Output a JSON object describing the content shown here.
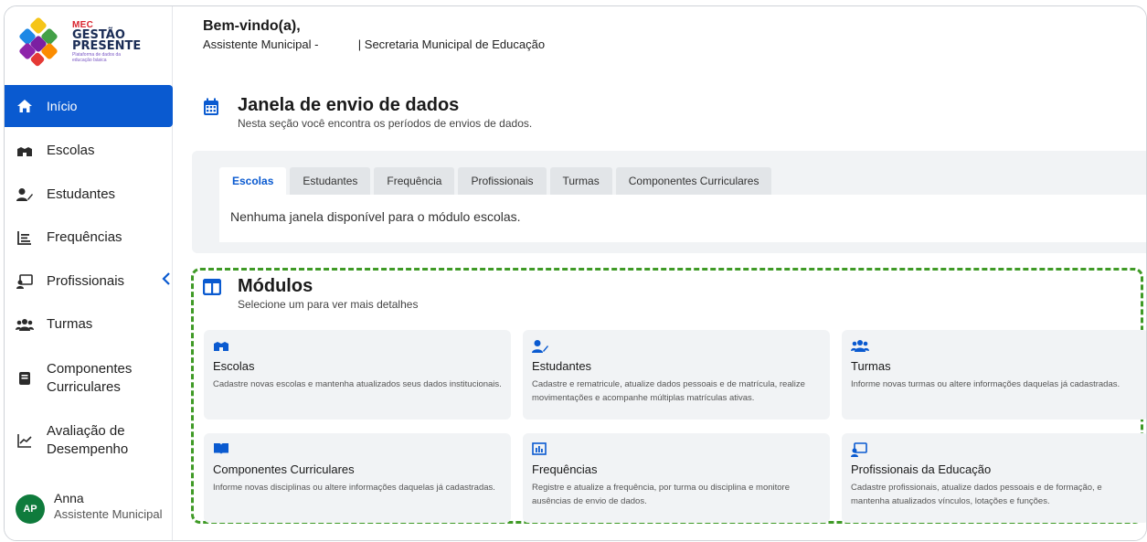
{
  "brand": {
    "mec": "MEC",
    "title_line1": "GESTÃO",
    "title_line2": "PRESENTE",
    "subtitle": "Plataforma de dados da educação básica"
  },
  "sidebar": {
    "items": [
      {
        "label": "Início",
        "icon": "home-icon",
        "active": true
      },
      {
        "label": "Escolas",
        "icon": "school-icon"
      },
      {
        "label": "Estudantes",
        "icon": "student-icon"
      },
      {
        "label": "Frequências",
        "icon": "list-icon"
      },
      {
        "label": "Profissionais",
        "icon": "presentation-icon"
      },
      {
        "label": "Turmas",
        "icon": "groups-icon"
      },
      {
        "label": "Componentes Curriculares",
        "icon": "book-icon"
      },
      {
        "label": "Avaliação de Desempenho",
        "icon": "trend-icon"
      }
    ],
    "user": {
      "initials": "AP",
      "name": "Anna",
      "role": "Assistente Municipal"
    }
  },
  "header": {
    "welcome": "Bem-vindo(a),",
    "role_line": "Assistente Municipal -            | Secretaria Municipal de Educação"
  },
  "janela": {
    "title": "Janela de envio de dados",
    "subtitle": "Nesta seção você encontra os períodos de envios de dados.",
    "tabs": [
      "Escolas",
      "Estudantes",
      "Frequência",
      "Profissionais",
      "Turmas",
      "Componentes Curriculares"
    ],
    "active_tab": "Escolas",
    "message": "Nenhuma janela disponível para o módulo escolas."
  },
  "modulos": {
    "title": "Módulos",
    "subtitle": "Selecione um para ver mais detalhes",
    "cards": [
      {
        "title": "Escolas",
        "desc": "Cadastre novas escolas e mantenha atualizados seus dados institucionais.",
        "icon": "school-icon"
      },
      {
        "title": "Estudantes",
        "desc": "Cadastre e rematricule, atualize dados pessoais e de matrícula, realize movimentações e acompanhe múltiplas matrículas ativas.",
        "icon": "student-icon"
      },
      {
        "title": "Turmas",
        "desc": "Informe novas turmas ou altere informações daquelas já cadastradas.",
        "icon": "groups-icon"
      },
      {
        "title": "Componentes Curriculares",
        "desc": "Informe novas disciplinas ou altere informações daquelas já cadastradas.",
        "icon": "book-icon"
      },
      {
        "title": "Frequências",
        "desc": "Registre e atualize a frequência, por turma ou disciplina e monitore ausências de envio de dados.",
        "icon": "chart-icon"
      },
      {
        "title": "Profissionais da Educação",
        "desc": "Cadastre profissionais, atualize dados pessoais e de formação, e mantenha atualizados vínculos, lotações e funções.",
        "icon": "presentation-icon"
      }
    ]
  },
  "colors": {
    "accent": "#0a5ad0",
    "highlight": "#3f9a26",
    "avatar": "#0f7b3c"
  }
}
